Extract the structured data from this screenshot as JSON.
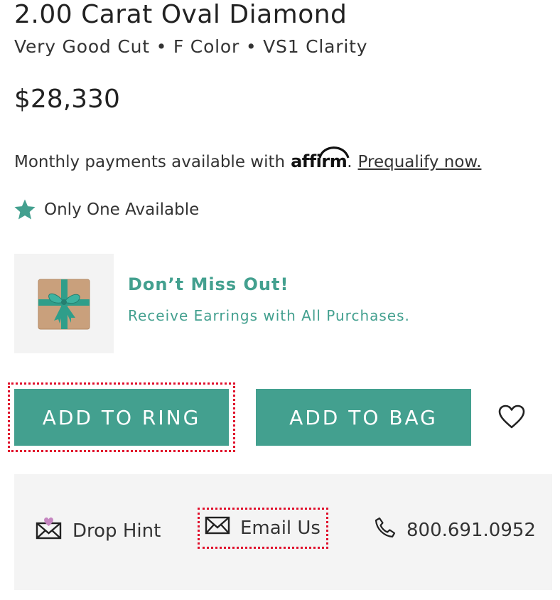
{
  "product": {
    "title": "2.00 Carat Oval Diamond",
    "specs": "Very Good Cut • F Color • VS1 Clarity",
    "price": "$28,330"
  },
  "financing": {
    "text": "Monthly payments available with",
    "provider": "affirm",
    "period": ".",
    "link": "Prequalify now."
  },
  "availability": {
    "icon": "star-icon",
    "text": "Only One Available"
  },
  "promo": {
    "icon": "gift-box-icon",
    "title": "Don’t Miss Out!",
    "subtitle": "Receive Earrings with All Purchases."
  },
  "actions": {
    "add_to_ring": "ADD TO RING",
    "add_to_bag": "ADD TO BAG",
    "wishlist_icon": "heart-outline-icon"
  },
  "contact": {
    "drop_hint": "Drop Hint",
    "email_us": "Email Us",
    "phone": "800.691.0952"
  },
  "colors": {
    "accent": "#43a08f",
    "highlight": "#e0102c",
    "heart_badge": "#c586c0"
  }
}
